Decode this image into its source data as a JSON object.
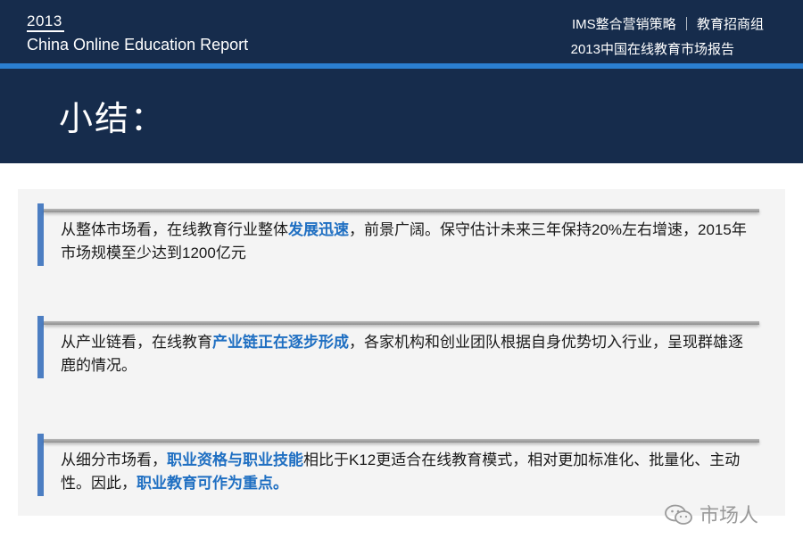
{
  "header": {
    "year": "2013",
    "report_title": "China Online Education Report",
    "right_line1": "IMS整合营销策略 ｜ 教育招商组",
    "right_line2": "2013中国在线教育市场报告",
    "section_title": "小结："
  },
  "items": [
    {
      "parts": [
        {
          "text": "从整体市场看，在线教育行业整体",
          "highlight": false
        },
        {
          "text": "发展迅速",
          "highlight": true
        },
        {
          "text": "，前景广阔。保守估计未来三年保持20%左右增速，2015年市场规模至少达到1200亿元",
          "highlight": false
        }
      ]
    },
    {
      "parts": [
        {
          "text": "从产业链看，在线教育",
          "highlight": false
        },
        {
          "text": "产业链正在逐步形成",
          "highlight": true
        },
        {
          "text": "，各家机构和创业团队根据自身优势切入行业，呈现群雄逐鹿的情况。",
          "highlight": false
        }
      ]
    },
    {
      "parts": [
        {
          "text": "从细分市场看，",
          "highlight": false
        },
        {
          "text": "职业资格与职业技能",
          "highlight": true
        },
        {
          "text": "相比于K12更适合在线教育模式，相对更加标准化、批量化、主动性。因此，",
          "highlight": false
        },
        {
          "text": "职业教育可作为重点。",
          "highlight": true
        }
      ]
    }
  ],
  "watermark": {
    "icon": "wechat-icon",
    "text": "市场人"
  },
  "colors": {
    "header_bg": "#162c4c",
    "accent_rule": "#2b7fd0",
    "highlight": "#1f6fc2",
    "side_bar": "#4c7ec2"
  }
}
